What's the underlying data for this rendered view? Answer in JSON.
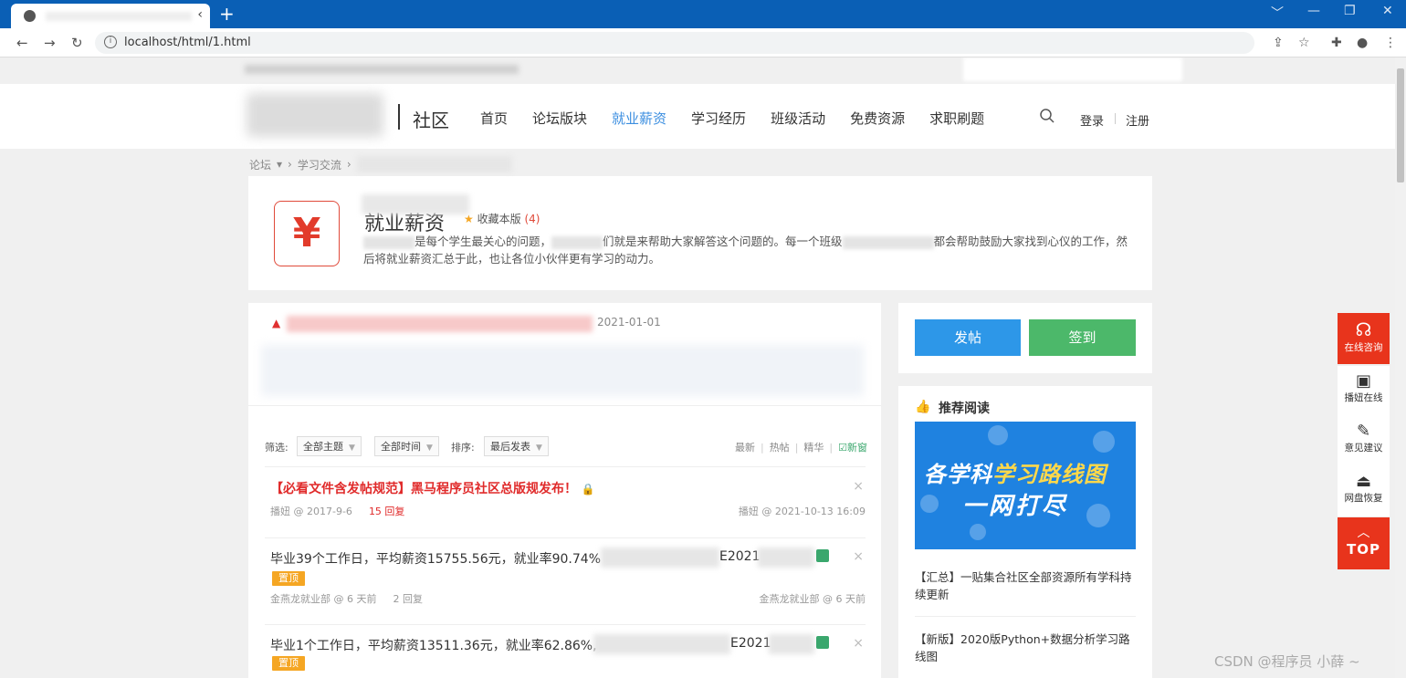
{
  "browser": {
    "new_tab": "+",
    "url": "localhost/html/1.html",
    "window_controls": [
      "﹀",
      "—",
      "❐",
      "✕"
    ]
  },
  "header": {
    "site_name": "社区",
    "nav": [
      "首页",
      "论坛版块",
      "就业薪资",
      "学习经历",
      "班级活动",
      "免费资源",
      "求职刷题"
    ],
    "active_nav": "就业薪资",
    "login": "登录",
    "register": "注册"
  },
  "breadcrumb": [
    "论坛",
    "学习交流"
  ],
  "forum": {
    "icon": "¥",
    "title": "就业薪资",
    "favorite_label": "收藏本版",
    "favorite_count": "(4)",
    "desc_a": "是每个学生最关心的问题，",
    "desc_b": "们就是来帮助大家解答这个问题的。每一个班级",
    "desc_c": "都会帮助鼓励大家找到心仪的工作，然后将就业薪资汇总于此，也让各位小伙伴更有学习的动力。"
  },
  "notice": {
    "date": "2021-01-01"
  },
  "filter": {
    "label_filter": "筛选:",
    "theme": "全部主题",
    "time": "全部时间",
    "label_sort": "排序:",
    "sort": "最后发表",
    "links": [
      "最新",
      "热帖",
      "精华"
    ],
    "new_window": "新窗"
  },
  "threads": [
    {
      "title": "【必看文件含发帖规范】黑马程序员社区总版规发布！",
      "author_time": "播妞 @ 2017-9-6",
      "replies": "15 回复",
      "last": "播妞 @ 2021-10-13 16:09"
    },
    {
      "title": "毕业39个工作日，平均薪资15755.56元，就业率90.74%",
      "title_tail": "E2021",
      "badge": "置顶",
      "author_time": "金燕龙就业部 @ 6 天前",
      "replies": "2 回复",
      "last": "金燕龙就业部 @ 6 天前"
    },
    {
      "title": "毕业1个工作日，平均薪资13511.36元，就业率62.86%,",
      "title_tail": "E2021",
      "badge": "置顶"
    }
  ],
  "sidebar": {
    "post_button": "发帖",
    "sign_button": "签到",
    "rec_title": "推荐阅读",
    "banner_line1a": "各学科",
    "banner_line1b": "学习路线图",
    "banner_line2": "一网打尽",
    "rec_items": [
      "【汇总】一贴集合社区全部资源所有学科持续更新",
      "【新版】2020版Python+数据分析学习路线图"
    ]
  },
  "floatbar": {
    "consult": "在线咨询",
    "items": [
      "播妞在线",
      "意见建议",
      "网盘恢复"
    ],
    "top": "TOP"
  },
  "watermark": "CSDN @程序员 小薛 ~",
  "colors": {
    "brand_blue": "#0a5fb5",
    "nav_active": "#3b8ee0",
    "post_btn": "#2d97e8",
    "sign_btn": "#4cb86a",
    "float_red": "#e8341c"
  }
}
